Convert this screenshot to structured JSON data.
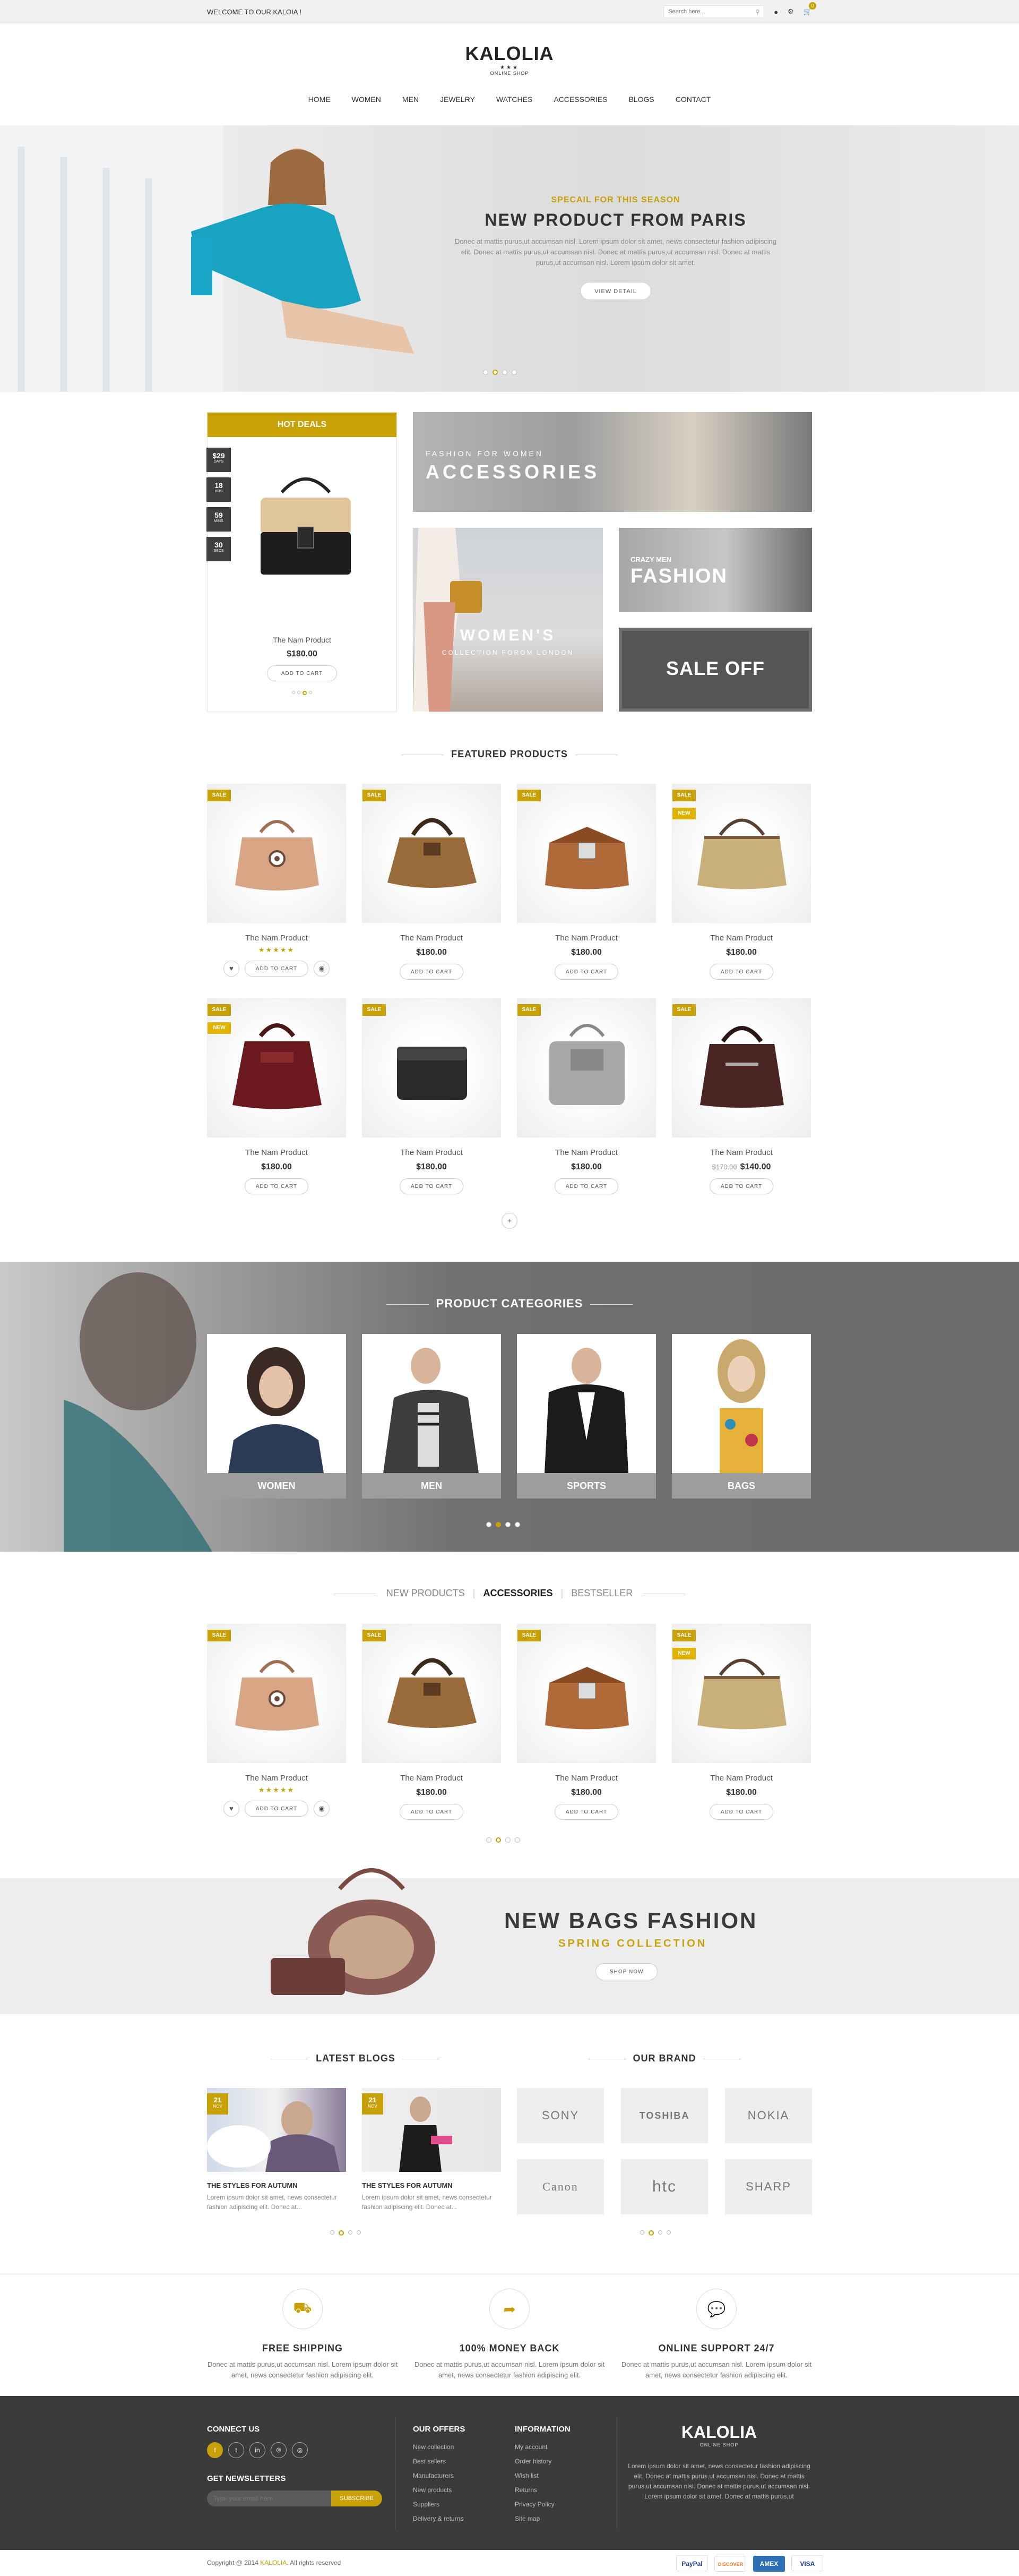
{
  "topbar": {
    "welcome": "WELCOME TO OUR KALOIA !",
    "search_placeholder": "Search here...",
    "cart_count": "0"
  },
  "logo": {
    "name": "KALOLIA",
    "stars": "★★★",
    "tagline": "ONLINE SHOP"
  },
  "nav": [
    "HOME",
    "WOMEN",
    "MEN",
    "JEWELRY",
    "WATCHES",
    "ACCESSORIES",
    "BLOGS",
    "CONTACT"
  ],
  "hero": {
    "pre": "SPECAIL FOR THIS SEASON",
    "title": "NEW PRODUCT FROM PARIS",
    "text": "Donec at mattis purus,ut accumsan nisl. Lorem ipsum dolor sit amet, news consectetur fashion adipiscing elit. Donec at mattis purus,ut accumsan nisl. Donec at mattis purus,ut accumsan nisl. Donec at mattis purus,ut accumsan nisl. Lorem ipsum dolor sit amet.",
    "button": "VIEW DETAIL"
  },
  "deals": {
    "title": "HOT DEALS",
    "countdown": [
      {
        "v": "$29",
        "l": "DAYS"
      },
      {
        "v": "18",
        "l": "HRS"
      },
      {
        "v": "59",
        "l": "MINS"
      },
      {
        "v": "30",
        "l": "SECS"
      }
    ],
    "product": "The Nam Product",
    "price": "$180.00",
    "button": "ADD TO CART"
  },
  "banners": {
    "accessories_pre": "FASHION FOR WOMEN",
    "accessories": "ACCESSORIES",
    "womens": "WOMEN'S",
    "womens_sub": "COLLECTION FOROM LONDON",
    "fashion_pre": "CRAZY MEN",
    "fashion": "FASHION",
    "sale": "SALE OFF"
  },
  "featured": {
    "title": "FEATURED PRODUCTS",
    "products": [
      {
        "name": "The Nam Product",
        "price": "",
        "sale": "SALE",
        "new": "",
        "stars": "★★★★★",
        "btn": "ADD TO CART"
      },
      {
        "name": "The Nam Product",
        "price": "$180.00",
        "sale": "SALE",
        "new": "",
        "stars": "",
        "btn": "ADD TO CART"
      },
      {
        "name": "The Nam Product",
        "price": "$180.00",
        "sale": "SALE",
        "new": "",
        "stars": "",
        "btn": "ADD TO CART"
      },
      {
        "name": "The Nam Product",
        "price": "$180.00",
        "sale": "SALE",
        "new": "NEW",
        "stars": "",
        "btn": "ADD TO CART"
      },
      {
        "name": "The Nam Product",
        "price": "$180.00",
        "sale": "SALE",
        "new": "NEW",
        "stars": "",
        "btn": "ADD TO CART"
      },
      {
        "name": "The Nam Product",
        "price": "$180.00",
        "sale": "SALE",
        "new": "",
        "stars": "",
        "btn": "ADD TO CART"
      },
      {
        "name": "The Nam Product",
        "price": "$180.00",
        "sale": "SALE",
        "new": "",
        "stars": "",
        "btn": "ADD TO CART"
      },
      {
        "name": "The Nam Product",
        "price": "$140.00",
        "old": "$170.00",
        "sale": "SALE",
        "new": "",
        "stars": "",
        "btn": "ADD TO CART"
      }
    ]
  },
  "categories": {
    "title": "PRODUCT CATEGORIES",
    "items": [
      "WOMEN",
      "MEN",
      "SPORTS",
      "BAGS"
    ]
  },
  "tabs": {
    "t1": "NEW PRODUCTS",
    "t2": "ACCESSORIES",
    "t3": "BESTSELLER"
  },
  "tab_products": [
    {
      "name": "The Nam Product",
      "price": "",
      "sale": "SALE",
      "new": "",
      "stars": "★★★★★",
      "btn": "ADD TO CART"
    },
    {
      "name": "The Nam Product",
      "price": "$180.00",
      "sale": "SALE",
      "new": "",
      "stars": "",
      "btn": "ADD TO CART"
    },
    {
      "name": "The Nam Product",
      "price": "$180.00",
      "sale": "SALE",
      "new": "",
      "stars": "",
      "btn": "ADD TO CART"
    },
    {
      "name": "The Nam Product",
      "price": "$180.00",
      "sale": "SALE",
      "new": "NEW",
      "stars": "",
      "btn": "ADD TO CART"
    }
  ],
  "bags_banner": {
    "title": "NEW BAGS FASHION",
    "sub": "SPRING COLLECTION",
    "button": "SHOP NOW"
  },
  "blogs": {
    "title": "LATEST BLOGS",
    "items": [
      {
        "day": "21",
        "month": "NOV",
        "title": "THE STYLES FOR AUTUMN",
        "text": "Lorem ipsum dolor sit amet, news consectetur fashion adipiscing elit. Donec at..."
      },
      {
        "day": "21",
        "month": "NOV",
        "title": "THE STYLES FOR AUTUMN",
        "text": "Lorem ipsum dolor sit amet, news consectetur fashion adipiscing elit. Donec at..."
      }
    ]
  },
  "brands": {
    "title": "OUR BRAND",
    "items": [
      "SONY",
      "TOSHIBA",
      "NOKIA",
      "Canon",
      "htc",
      "SHARP"
    ]
  },
  "features": [
    {
      "icon": "truck-icon",
      "title": "FREE SHIPPING",
      "text": "Donec at mattis purus,ut accumsan nisl. Lorem ipsum dolor sit amet, news consectetur fashion adipiscing elit."
    },
    {
      "icon": "share-icon",
      "title": "100% MONEY BACK",
      "text": "Donec at mattis purus,ut accumsan nisl. Lorem ipsum dolor sit amet, news consectetur fashion adipiscing elit."
    },
    {
      "icon": "chat-icon",
      "title": "ONLINE SUPPORT 24/7",
      "text": "Donec at mattis purus,ut accumsan nisl. Lorem ipsum dolor sit amet, news consectetur fashion adipiscing elit."
    }
  ],
  "footer": {
    "connect": "CONNECT US",
    "newsletter": "GET NEWSLETTERS",
    "newsletter_placeholder": "Type your email here",
    "subscribe": "SUBSCRIBE",
    "offers_title": "OUR OFFERS",
    "offers": [
      "New collection",
      "Best sellers",
      "Manufacturers",
      "New products",
      "Suppliers",
      "Delivery & returns"
    ],
    "info_title": "INFORMATION",
    "info": [
      "My account",
      "Order history",
      "Wish list",
      "Returns",
      "Privacy Policy",
      "Site map"
    ],
    "logo": "KALOLIA",
    "logo_tag": "ONLINE SHOP",
    "about": "Lorem ipsum dolor sit amet, news consectetur fashion adipiscing elit. Donec at mattis purus,ut accumsan nisl. Donec at mattis purus,ut accumsan nisl. Donec at mattis purus,ut accumsan nisl. Lorem ipsum dolor sit amet. Donec at mattis purus,ut"
  },
  "copyright": {
    "pre": "Copyright @ 2014 ",
    "brand": "KALOLIA",
    "post": ". All rights reserved",
    "pay": [
      "PayPal",
      "DISCOVER",
      "AMEX",
      "VISA"
    ]
  },
  "colors": {
    "accent": "#c7a106",
    "dark": "#3b3b3b"
  }
}
